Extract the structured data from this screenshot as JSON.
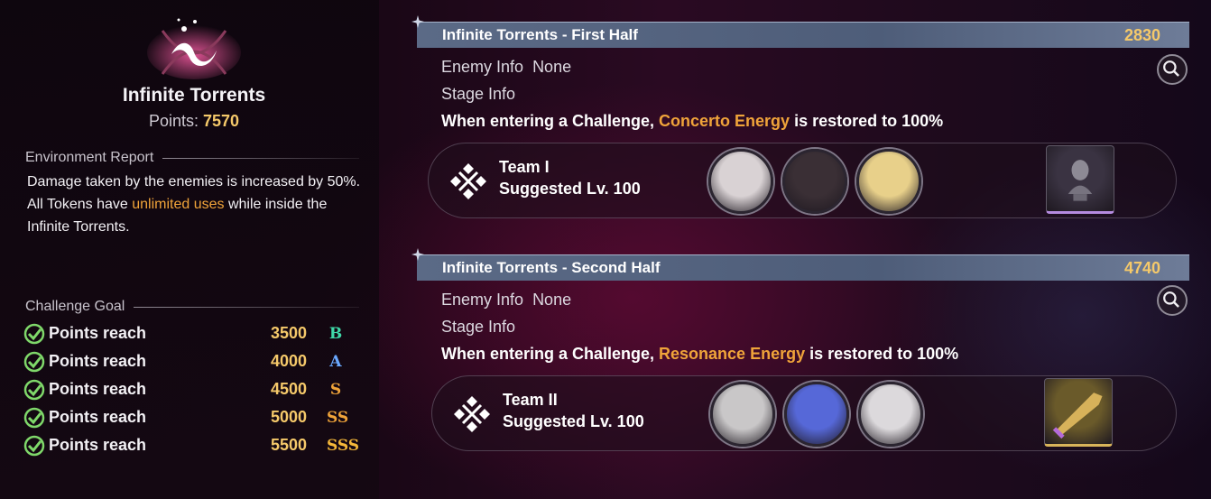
{
  "mode": {
    "title": "Infinite Torrents",
    "points_label": "Points:",
    "points_value": "7570"
  },
  "environment": {
    "heading": "Environment Report",
    "line1": "Damage taken by the enemies is increased by 50%.",
    "line2_pre": "All Tokens have ",
    "line2_highlight": "unlimited uses",
    "line2_post": " while inside the Infinite Torrents."
  },
  "goals": {
    "heading": "Challenge Goal",
    "items": [
      {
        "label": "Points reach",
        "value": "3500",
        "rank": "B",
        "rank_color": "#3fd8a8"
      },
      {
        "label": "Points reach",
        "value": "4000",
        "rank": "A",
        "rank_color": "#6aa8ff"
      },
      {
        "label": "Points reach",
        "value": "4500",
        "rank": "S",
        "rank_color": "#f0a43a"
      },
      {
        "label": "Points reach",
        "value": "5000",
        "rank": "SS",
        "rank_color": "#f0a43a"
      },
      {
        "label": "Points reach",
        "value": "5500",
        "rank": "SSS",
        "rank_color": "#f5b83a"
      }
    ]
  },
  "challenges": [
    {
      "title": "Infinite Torrents - First Half",
      "points": "2830",
      "enemy_label": "Enemy Info",
      "enemy_value": "None",
      "stage_label": "Stage Info",
      "desc_pre": "When entering a Challenge, ",
      "desc_highlight": "Concerto Energy",
      "desc_post": " is restored to 100%",
      "team_name": "Team I",
      "team_level": "Suggested Lv. 100",
      "portrait_colors": [
        "#d9d2d4",
        "#3a2f35",
        "#e8d08a"
      ],
      "item_color": "#3a3342"
    },
    {
      "title": "Infinite Torrents - Second Half",
      "points": "4740",
      "enemy_label": "Enemy Info",
      "enemy_value": "None",
      "stage_label": "Stage Info",
      "desc_pre": "When entering a Challenge, ",
      "desc_highlight": "Resonance Energy",
      "desc_post": " is restored to 100%",
      "team_name": "Team II",
      "team_level": "Suggested Lv. 100",
      "portrait_colors": [
        "#c9c7c8",
        "#5668d8",
        "#dcd9dc"
      ],
      "item_color": "#6a5a2a"
    }
  ],
  "colors": {
    "accent_gold": "#f5c96a",
    "highlight_orange": "#f0a43a",
    "banner_blue": "#5b6a86",
    "check_green": "#7fd86a"
  }
}
